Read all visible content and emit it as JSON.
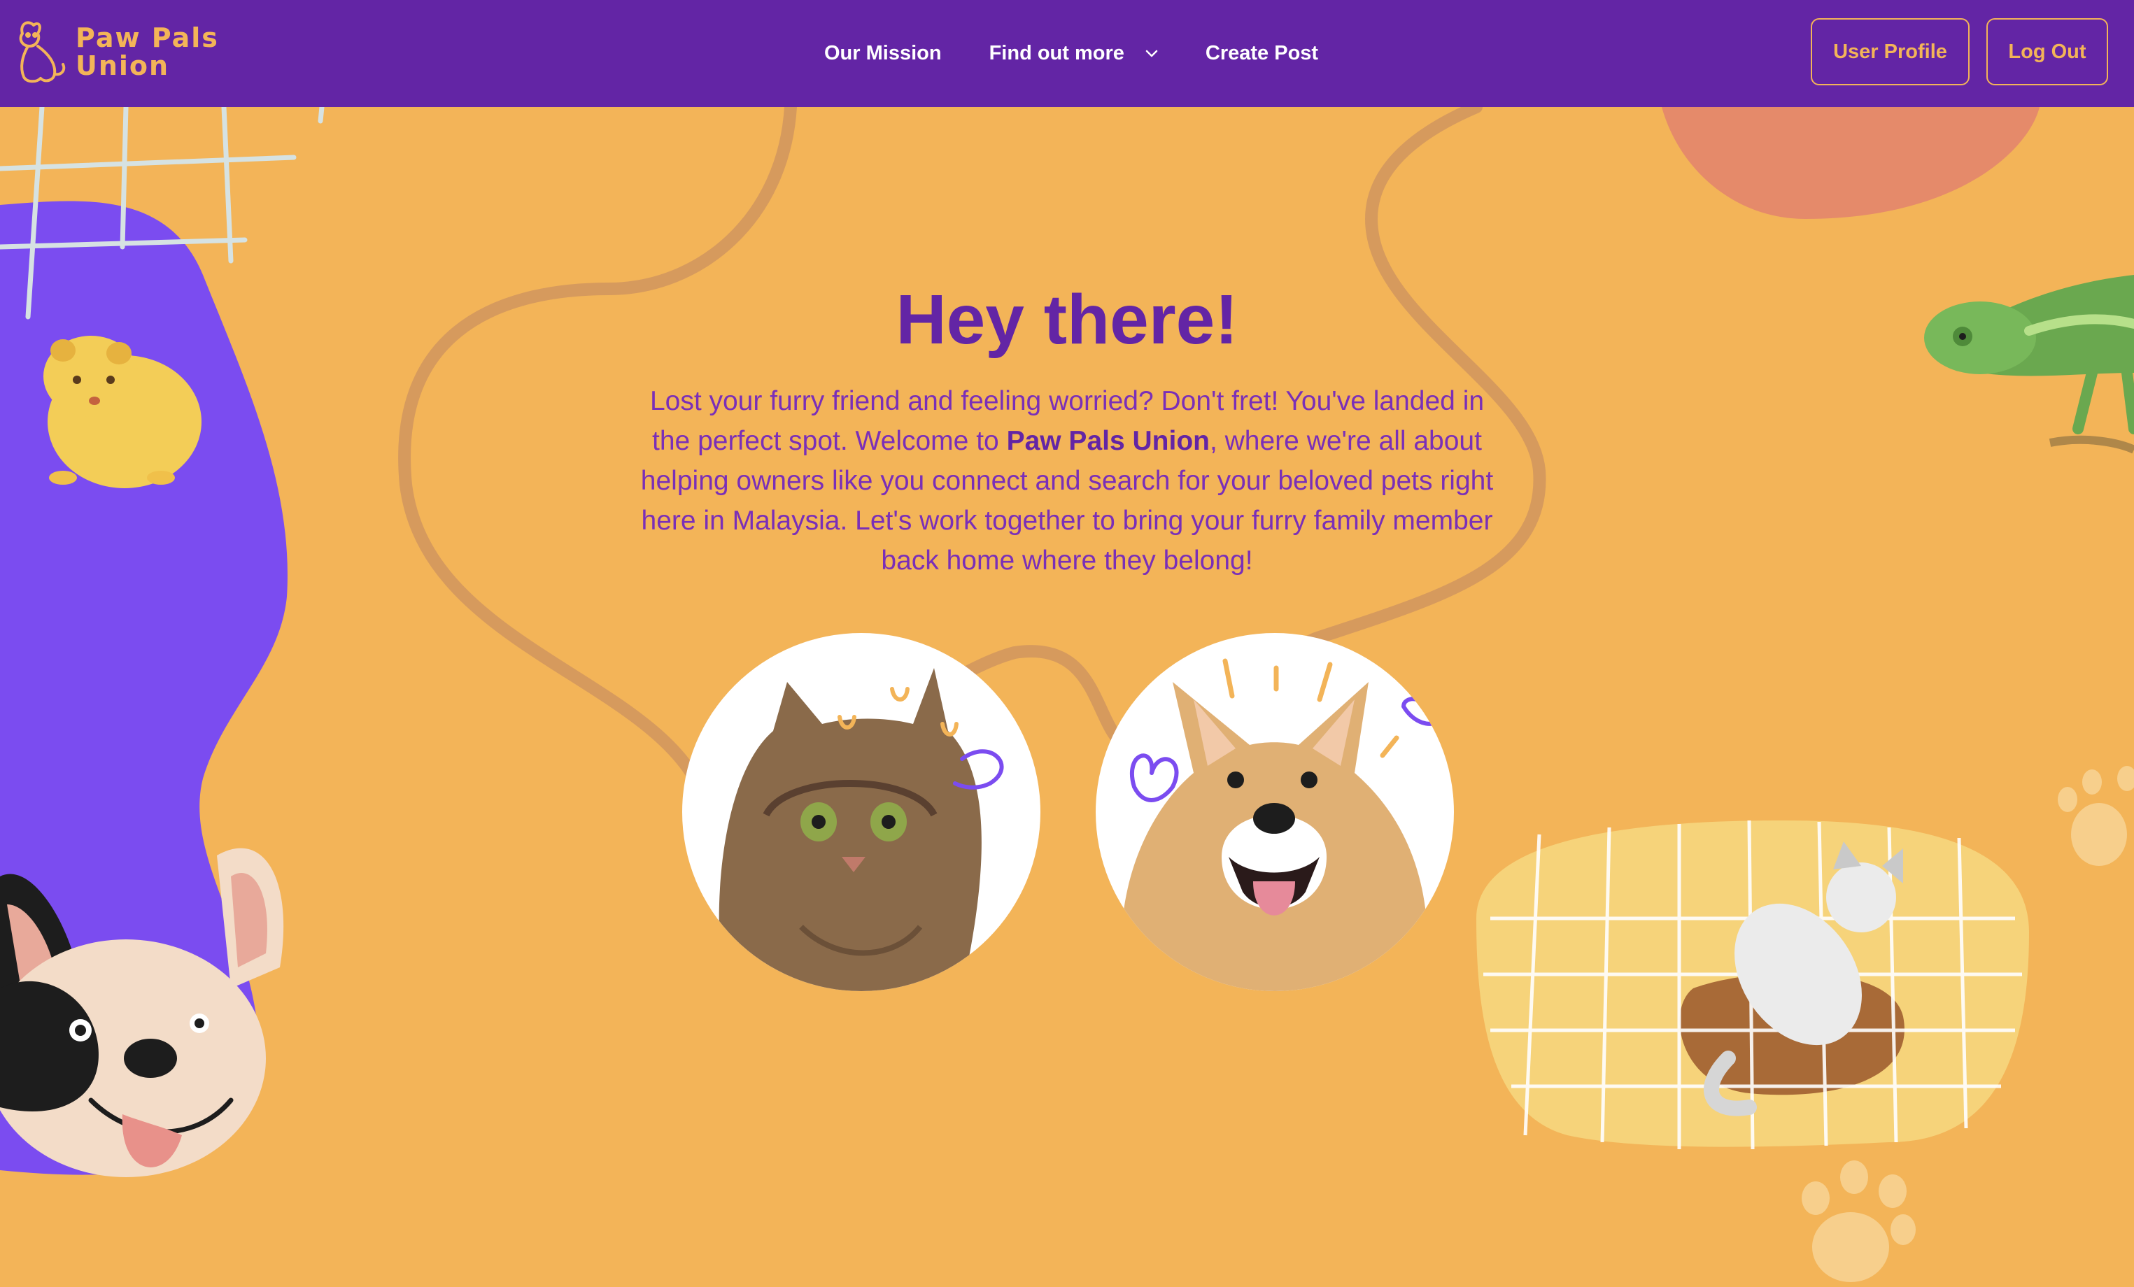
{
  "brand": {
    "name_line1": "Paw Pals",
    "name_line2": "Union",
    "logo_icon": "dog-cat-logo-icon"
  },
  "nav": {
    "items": [
      {
        "label": "Our Mission"
      },
      {
        "label": "Find out more",
        "icon": "chevron-down-icon"
      },
      {
        "label": "Create Post"
      }
    ],
    "user_profile_label": "User Profile",
    "logout_label": "Log Out"
  },
  "hero": {
    "title": "Hey there!",
    "text_before": "Lost your furry friend and feeling worried? Don't fret! You've landed in the perfect spot. Welcome to ",
    "text_bold": "Paw Pals Union",
    "text_after": ", where we're all about helping owners like you connect and search for your beloved pets right here in Malaysia. Let's work together to bring your furry family member back home where they belong!"
  },
  "images": {
    "left_circle": "cat-photo",
    "right_circle": "corgi-photo"
  },
  "colors": {
    "nav_bg": "#6325a5",
    "page_bg": "#f3b458",
    "accent_purple": "#7b4cf0",
    "title_purple": "#6325a5",
    "accent_orange": "#f3b458"
  }
}
